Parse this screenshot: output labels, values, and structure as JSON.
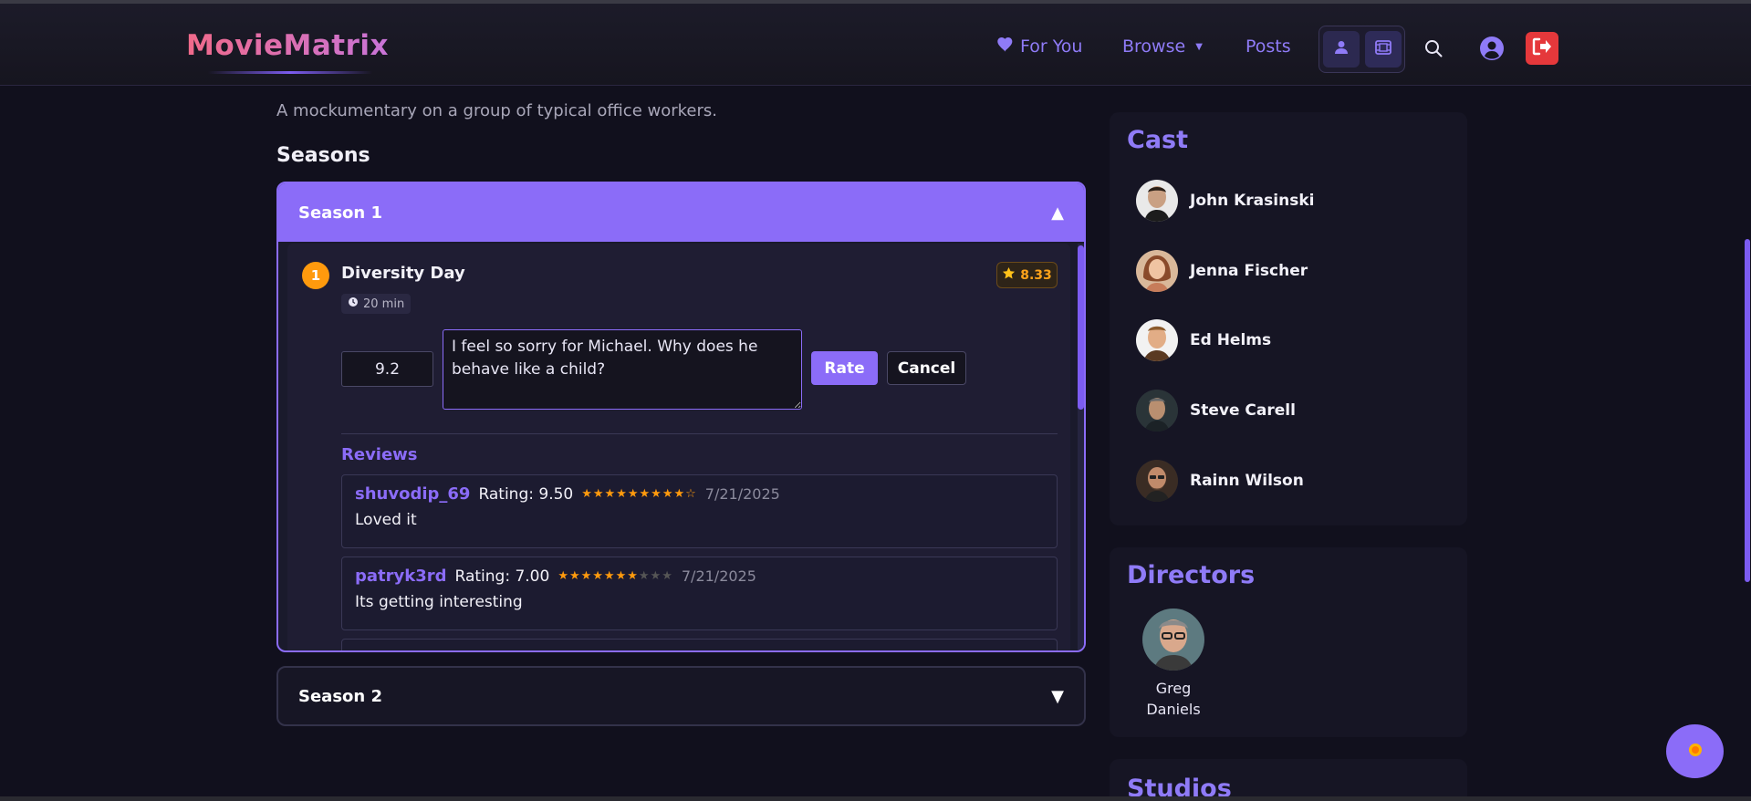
{
  "brand": {
    "name": "MovieMatrix"
  },
  "nav": {
    "for_you": "For You",
    "browse": "Browse",
    "posts": "Posts"
  },
  "overview": "A mockumentary on a group of typical office workers.",
  "seasons_heading": "Seasons",
  "seasons": [
    {
      "title": "Season 1",
      "expanded": true,
      "episode": {
        "number": "1",
        "title": "Diversity Day",
        "runtime": "20 min",
        "rating": "8.33",
        "rating_input": "9.2",
        "review_draft": "I feel so sorry for Michael. Why does he behave like a child?",
        "rate_label": "Rate",
        "cancel_label": "Cancel"
      },
      "reviews_heading": "Reviews",
      "reviews": [
        {
          "user": "shuvodip_69",
          "rating": "Rating: 9.50",
          "stars": 9.5,
          "date": "7/21/2025",
          "text": "Loved it"
        },
        {
          "user": "patryk3rd",
          "rating": "Rating: 7.00",
          "stars": 7.0,
          "date": "7/21/2025",
          "text": "Its getting interesting"
        }
      ]
    },
    {
      "title": "Season 2",
      "expanded": false
    }
  ],
  "cast": {
    "title": "Cast",
    "members": [
      {
        "name": "John Krasinski"
      },
      {
        "name": "Jenna Fischer"
      },
      {
        "name": "Ed Helms"
      },
      {
        "name": "Steve Carell"
      },
      {
        "name": "Rainn Wilson"
      }
    ]
  },
  "directors": {
    "title": "Directors",
    "members": [
      {
        "name": "Greg Daniels"
      }
    ]
  },
  "studios": {
    "title": "Studios"
  },
  "colors": {
    "accent": "#8b6cf8",
    "background": "#11101d",
    "star": "#ff9a0d",
    "logout": "#e5383b"
  },
  "icons": {
    "for_you": "heart-icon",
    "browse": "caret-down-icon",
    "search": "search-icon",
    "profile": "user-circle-icon",
    "logout": "logout-icon",
    "runtime": "clock-icon",
    "rating": "star-icon",
    "theme": "sun-icon"
  }
}
